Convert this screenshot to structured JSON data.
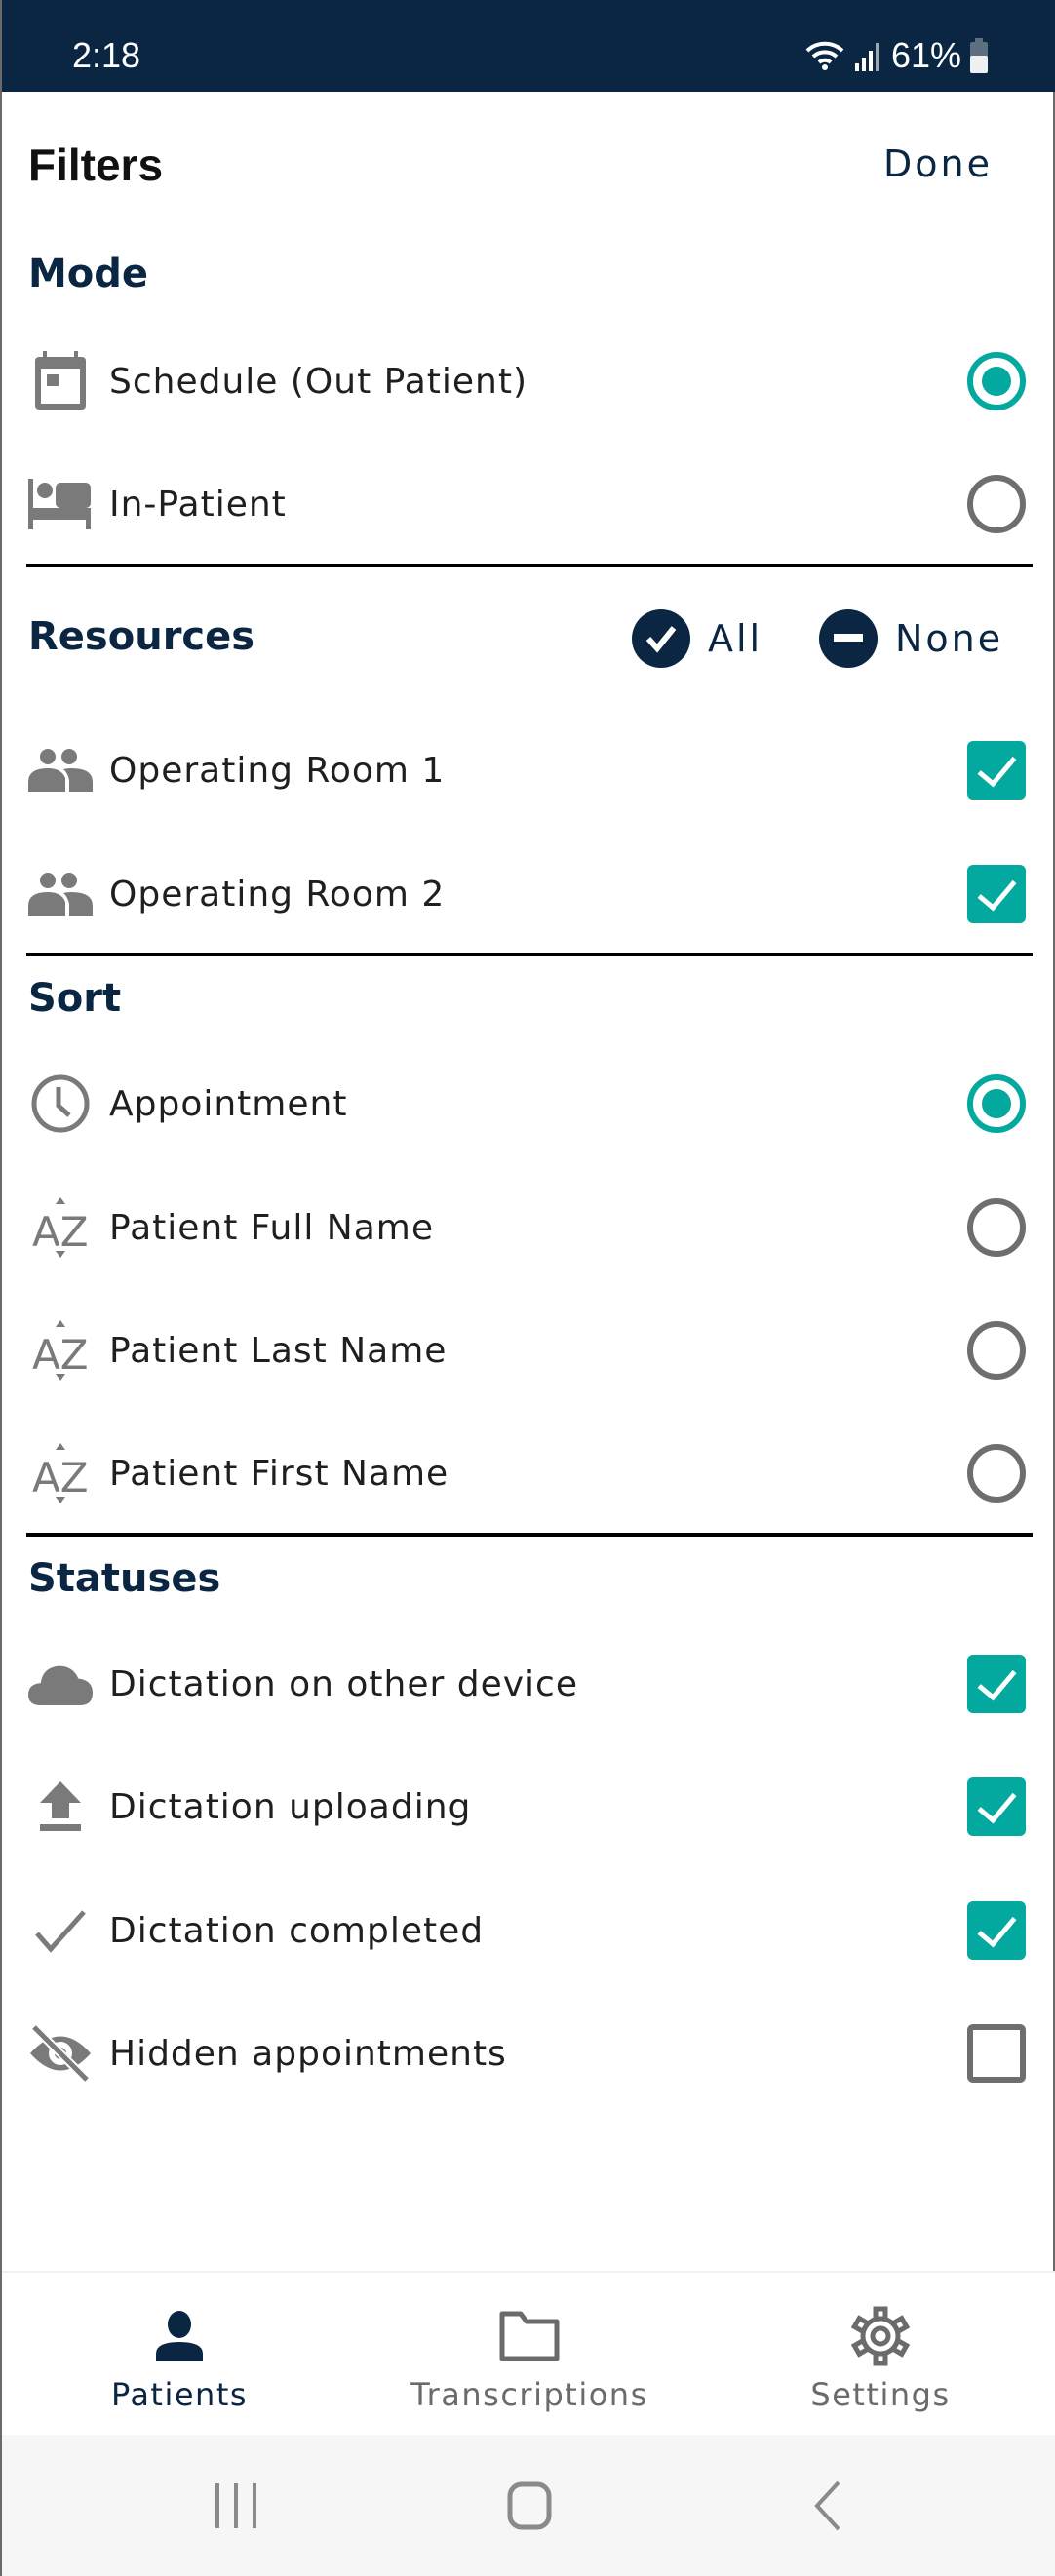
{
  "status_bar": {
    "time": "2:18",
    "battery": "61%"
  },
  "header": {
    "title": "Filters",
    "done_label": "Done"
  },
  "mode": {
    "title": "Mode",
    "items": [
      {
        "label": "Schedule (Out Patient)",
        "icon": "calendar-icon",
        "selected": true
      },
      {
        "label": "In-Patient",
        "icon": "bed-icon",
        "selected": false
      }
    ]
  },
  "resources": {
    "title": "Resources",
    "all_label": "All",
    "none_label": "None",
    "items": [
      {
        "label": "Operating Room 1",
        "icon": "people-icon",
        "checked": true
      },
      {
        "label": "Operating Room 2",
        "icon": "people-icon",
        "checked": true
      }
    ]
  },
  "sort": {
    "title": "Sort",
    "items": [
      {
        "label": "Appointment",
        "icon": "clock-icon",
        "selected": true
      },
      {
        "label": "Patient Full Name",
        "icon": "sort-az-icon",
        "selected": false
      },
      {
        "label": "Patient Last Name",
        "icon": "sort-az-icon",
        "selected": false
      },
      {
        "label": "Patient First Name",
        "icon": "sort-az-icon",
        "selected": false
      }
    ]
  },
  "statuses": {
    "title": "Statuses",
    "items": [
      {
        "label": "Dictation on other device",
        "icon": "cloud-icon",
        "checked": true
      },
      {
        "label": "Dictation uploading",
        "icon": "upload-icon",
        "checked": true
      },
      {
        "label": "Dictation completed",
        "icon": "check-icon",
        "checked": true
      },
      {
        "label": "Hidden appointments",
        "icon": "eye-off-icon",
        "checked": false
      }
    ]
  },
  "bottom_nav": {
    "items": [
      {
        "label": "Patients",
        "icon": "person-icon",
        "active": true
      },
      {
        "label": "Transcriptions",
        "icon": "folder-icon",
        "active": false
      },
      {
        "label": "Settings",
        "icon": "gear-icon",
        "active": false
      }
    ]
  },
  "colors": {
    "primary": "#0a2642",
    "accent": "#03a89e",
    "icon_gray": "#7a7a7a"
  }
}
